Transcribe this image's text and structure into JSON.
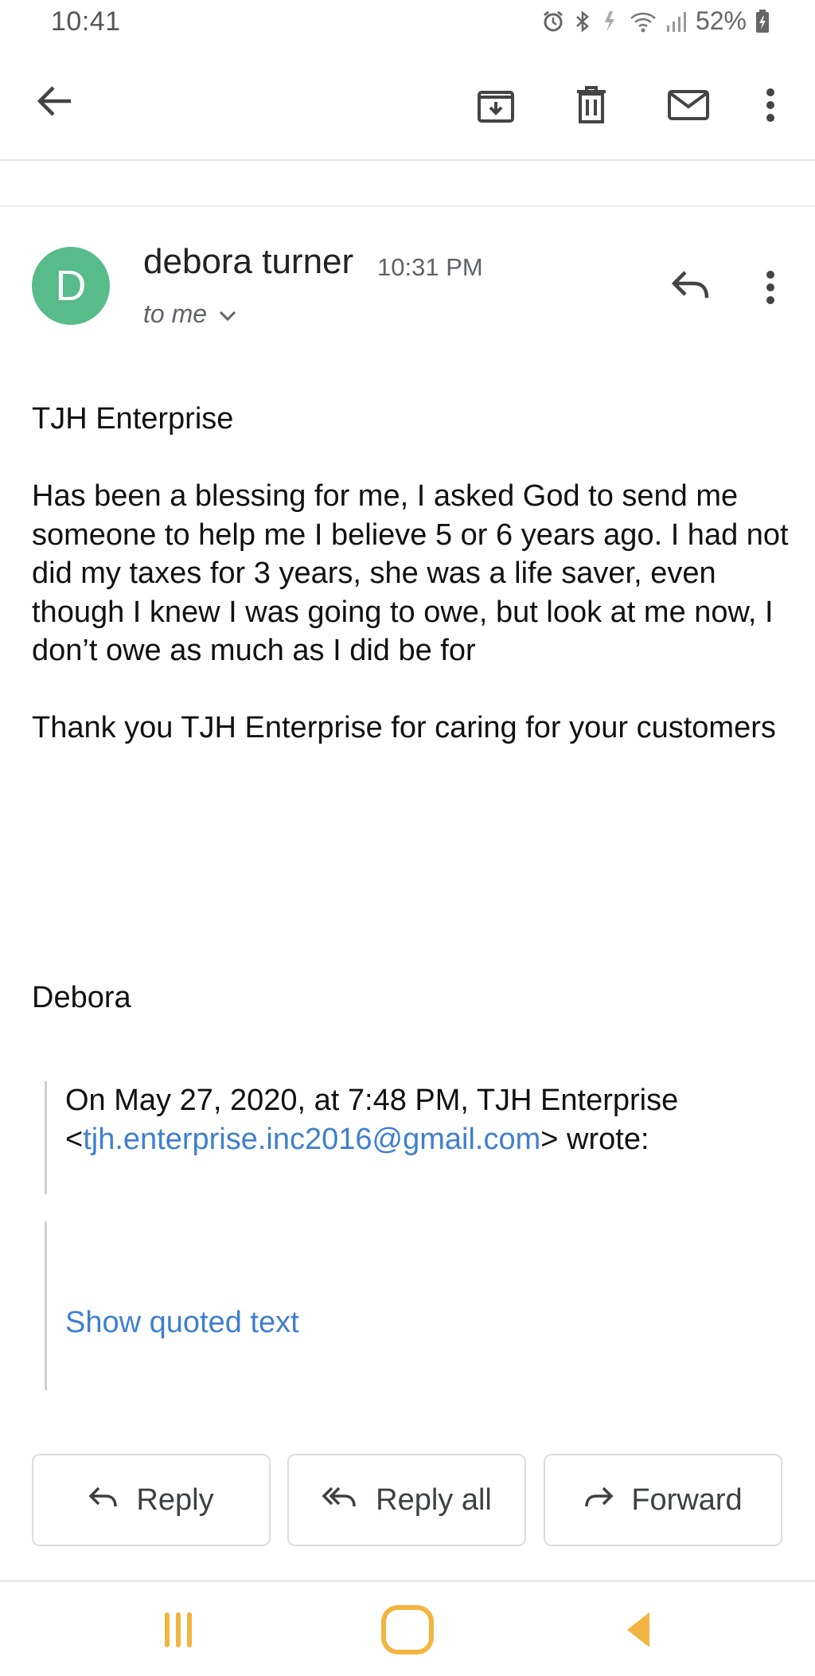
{
  "status_bar": {
    "time": "10:41",
    "battery": "52%",
    "icons": [
      "alarm-icon",
      "bluetooth-icon",
      "data-transfer-icon",
      "wifi-icon",
      "signal-icon",
      "battery-charging-icon"
    ]
  },
  "toolbar": {
    "icons": [
      "back-arrow-icon",
      "archive-icon",
      "delete-icon",
      "mark-unread-icon",
      "more-options-icon"
    ]
  },
  "message": {
    "avatar_letter": "D",
    "avatar_color": "#57bb8a",
    "sender": "debora turner",
    "time": "10:31 PM",
    "recipient": "to me",
    "body": [
      "TJH Enterprise",
      "Has been a blessing for me, I asked God to send me someone to help me I believe 5 or 6 years ago.  I had not did my taxes for 3 years, she was a life saver,  even though I knew I was going to owe, but look at me now, I don’t owe as much as I did be for",
      "Thank you TJH Enterprise for caring for your customers",
      "Debora"
    ],
    "quote": {
      "prefix": "On May 27, 2020, at 7:48 PM, TJH Enterprise <",
      "email": "tjh.enterprise.inc2016@gmail.com",
      "suffix": "> wrote:"
    },
    "show_quoted": "Show quoted text"
  },
  "actions": {
    "reply": "Reply",
    "reply_all": "Reply all",
    "forward": "Forward"
  },
  "colors": {
    "link": "#3f7fd0",
    "nav_icon": "#f2b441"
  }
}
